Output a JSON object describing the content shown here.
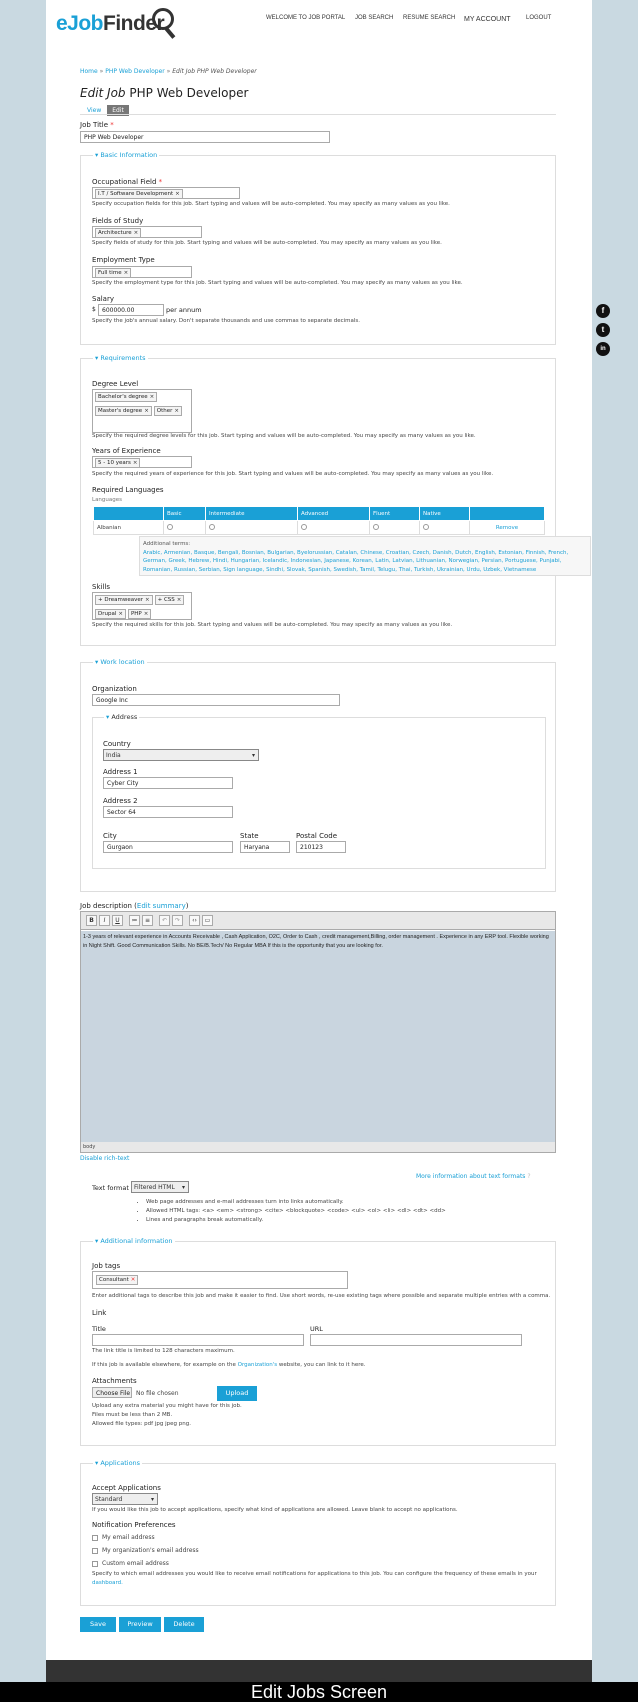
{
  "header": {
    "logo_main": "eJob",
    "logo_accent": "Finder",
    "nav": [
      "WELCOME TO JOB PORTAL",
      "JOB SEARCH",
      "RESUME SEARCH",
      "MY ACCOUNT",
      "LOGOUT"
    ]
  },
  "breadcrumb": {
    "home": "Home",
    "sep": " » ",
    "parent": "PHP Web Developer",
    "current": "Edit Job PHP Web Developer"
  },
  "page_title": {
    "prefix": "Edit Job",
    "name": "PHP Web Developer"
  },
  "tabs": {
    "view": "View",
    "edit": "Edit"
  },
  "job_title": {
    "label": "Job Title",
    "value": "PHP Web Developer"
  },
  "basic": {
    "legend": "Basic Information",
    "occ_label": "Occupational Field",
    "occ_chip": "I.T / Software Development",
    "occ_desc": "Specify occupation fields for this job. Start typing and values will be auto-completed. You may specify as many values as you like.",
    "study_label": "Fields of Study",
    "study_chip": "Architecture",
    "study_desc": "Specify fields of study for this job. Start typing and values will be auto-completed. You may specify as many values as you like.",
    "emp_label": "Employment Type",
    "emp_chip": "Full time",
    "emp_desc": "Specify the employment type for this job. Start typing and values will be auto-completed. You may specify as many values as you like.",
    "salary_label": "Salary",
    "currency": "$",
    "salary_value": "600000.00",
    "salary_suffix": "per annum",
    "salary_desc": "Specify the job's annual salary. Don't separate thousands and use commas to separate decimals."
  },
  "requirements": {
    "legend": "Requirements",
    "degree_label": "Degree Level",
    "degree_chips": [
      "Bachelor's degree",
      "Master's degree",
      "Other"
    ],
    "degree_desc": "Specify the required degree levels for this job. Start typing and values will be auto-completed. You may specify as many values as you like.",
    "exp_label": "Years of Experience",
    "exp_chip": "5 - 10 years",
    "exp_desc": "Specify the required years of experience for this job. Start typing and values will be auto-completed. You may specify as many values as you like.",
    "lang_label": "Required Languages",
    "lang_sub": "Languages",
    "lang_cols": [
      "",
      "Basic",
      "Intermediate",
      "Advanced",
      "Fluent",
      "Native",
      ""
    ],
    "lang_row": {
      "name": "Albanian",
      "remove": "Remove"
    },
    "add_terms_label": "Additional terms:",
    "add_terms": "Arabic, Armenian, Basque, Bengali, Bosnian, Bulgarian, Byelorussian, Catalan, Chinese, Croatian, Czech, Danish, Dutch, English, Estonian, Finnish, French, German, Greek, Hebrew, Hindi, Hungarian, Icelandic, Indonesian, Japanese, Korean, Latin, Latvian, Lithuanian, Norwegian, Persian, Portuguese, Punjabi, Romanian, Russian, Serbian, Sign language, Sindhi, Slovak, Spanish, Swedish, Tamil, Telugu, Thai, Turkish, Ukrainian, Urdu, Uzbek, Vietnamese",
    "skills_label": "Skills",
    "skills_chips": [
      "+ Dreamweaver",
      "+ CSS",
      "Drupal",
      "PHP"
    ],
    "skills_desc": "Specify the required skills for this job. Start typing and values will be auto-completed. You may specify as many values as you like."
  },
  "work": {
    "legend": "Work location",
    "org_label": "Organization",
    "org_value": "Google Inc",
    "addr_legend": "Address",
    "country_label": "Country",
    "country_value": "India",
    "addr1_label": "Address 1",
    "addr1_value": "Cyber City",
    "addr2_label": "Address 2",
    "addr2_value": "Sector 64",
    "city_label": "City",
    "city_value": "Gurgaon",
    "state_label": "State",
    "state_value": "Haryana",
    "postal_label": "Postal Code",
    "postal_value": "210123"
  },
  "jobdesc": {
    "label": "Job description (",
    "summary_link": "Edit summary",
    "label_end": ")",
    "toolbar": [
      "B",
      "I",
      "U",
      "≔",
      "≡",
      "↶",
      "↷",
      "‹›",
      "▭"
    ],
    "text": "1-3 years of relevant experience in Accounts Receivable , Cash Application, O2C, Order to Cash , credit management,Billing, order management . Experience in any ERP tool. Flexible working in Night Shift. Good Communication Skills. No BE/B.Tech/ No Regular MBA If this is the opportunity that you are looking for.",
    "footer": "body",
    "disable": "Disable rich-text"
  },
  "text_format": {
    "label": "Text format",
    "value": "Filtered HTML",
    "more": "More information about text formats",
    "tips": [
      "Web page addresses and e-mail addresses turn into links automatically.",
      "Allowed HTML tags: <a> <em> <strong> <cite> <blockquote> <code> <ul> <ol> <li> <dl> <dt> <dd>",
      "Lines and paragraphs break automatically."
    ]
  },
  "additional": {
    "legend": "Additional information",
    "tags_label": "Job tags",
    "tag_chip": "Consultant",
    "tags_desc": "Enter additional tags to describe this job and make it easier to find. Use short words, re-use existing tags where possible and separate multiple entries with a comma.",
    "link_label": "Link",
    "title_label": "Title",
    "url_label": "URL",
    "link_desc": "The link title is limited to 128 characters maximum.",
    "link_desc2_a": "If this job is available elsewhere, for example on the ",
    "link_desc2_b": "Organization's",
    "link_desc2_c": " website, you can link to it here.",
    "attach_label": "Attachments",
    "choose": "Choose File",
    "nofile": "No file chosen",
    "upload": "Upload",
    "attach_desc1": "Upload any extra material you might have for this job.",
    "attach_desc2": "Files must be less than 2 MB.",
    "attach_desc3": "Allowed file types: pdf jpg jpeg png."
  },
  "applications": {
    "legend": "Applications",
    "accept_label": "Accept Applications",
    "accept_value": "Standard",
    "accept_desc": "If you would like this job to accept applications, specify what kind of applications are allowed. Leave blank to accept no applications.",
    "notif_label": "Notification Preferences",
    "options": [
      "My email address",
      "My organization's email address",
      "Custom email address"
    ],
    "notif_desc1": "Specify to which email addresses you would like to receive email notifications for applications to this job. You can configure the frequency of these emails in your",
    "notif_desc2": "dashboard."
  },
  "actions": {
    "save": "Save",
    "preview": "Preview",
    "delete": "Delete"
  },
  "social": [
    "f",
    "t",
    "in"
  ],
  "caption": "Edit Jobs Screen",
  "colors": {
    "accent": "#1aa0d6",
    "editor_bg": "#c9d5df",
    "page_bg": "#c9d9e1"
  }
}
